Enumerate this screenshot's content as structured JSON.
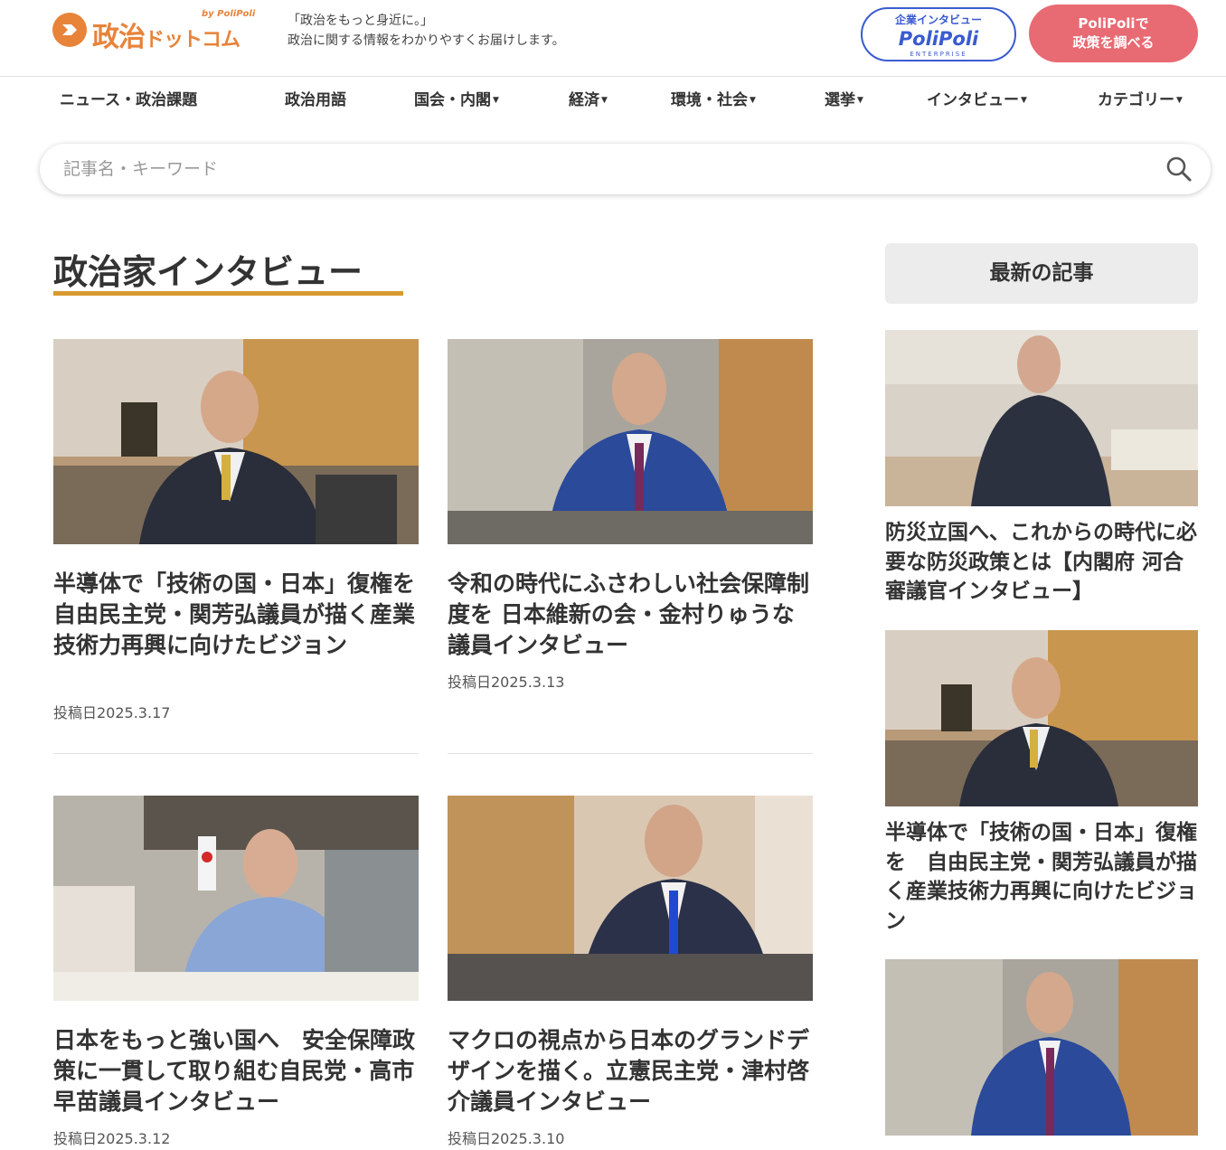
{
  "header": {
    "logo_main": "政治",
    "logo_sub": "ドットコム",
    "logo_by": "by PoliPoli",
    "tagline_1": "「政治をもっと身近に。」",
    "tagline_2": "政治に関する情報をわかりやすくお届けします。",
    "enterprise_label": "企業インタビュー",
    "enterprise_brand": "PoliPoli",
    "enterprise_sub": "ENTERPRISE",
    "policy_button_line1": "PoliPoliで",
    "policy_button_line2": "政策を調べる"
  },
  "nav": {
    "items": [
      {
        "label": "ニュース・政治課題",
        "dropdown": false
      },
      {
        "label": "政治用語",
        "dropdown": false
      },
      {
        "label": "国会・内閣",
        "dropdown": true
      },
      {
        "label": "経済",
        "dropdown": true
      },
      {
        "label": "環境・社会",
        "dropdown": true
      },
      {
        "label": "選挙",
        "dropdown": true
      },
      {
        "label": "インタビュー",
        "dropdown": true
      },
      {
        "label": "カテゴリー",
        "dropdown": true
      }
    ],
    "caret": "▼"
  },
  "search": {
    "placeholder": "記事名・キーワード",
    "icon": "search-icon"
  },
  "main": {
    "section_title": "政治家インタビュー",
    "articles": [
      {
        "title": "半導体で「技術の国・日本」復権を　自由民主党・関芳弘議員が描く産業技術力再興に向けたビジョン",
        "date": "投稿日2025.3.17"
      },
      {
        "title": "令和の時代にふさわしい社会保障制度を 日本維新の会・金村りゅうな議員インタビュー",
        "date": "投稿日2025.3.13"
      },
      {
        "title": "日本をもっと強い国へ　安全保障政策に一貫して取り組む自民党・高市早苗議員インタビュー",
        "date": "投稿日2025.3.12"
      },
      {
        "title": "マクロの視点から日本のグランドデザインを描く。立憲民主党・津村啓介議員インタビュー",
        "date": "投稿日2025.3.10"
      }
    ]
  },
  "sidebar": {
    "heading": "最新の記事",
    "articles": [
      {
        "title": "防災立国へ、これからの時代に必要な防災政策とは【内閣府 河合審議官インタビュー】"
      },
      {
        "title": "半導体で「技術の国・日本」復権を　自由民主党・関芳弘議員が描く産業技術力再興に向けたビジョン"
      },
      {
        "title": ""
      }
    ]
  },
  "colors": {
    "brand_orange": "#e8833a",
    "accent_underline": "#d89a2e",
    "enterprise_blue": "#3a5bd0",
    "policy_pink": "#e86a73"
  }
}
